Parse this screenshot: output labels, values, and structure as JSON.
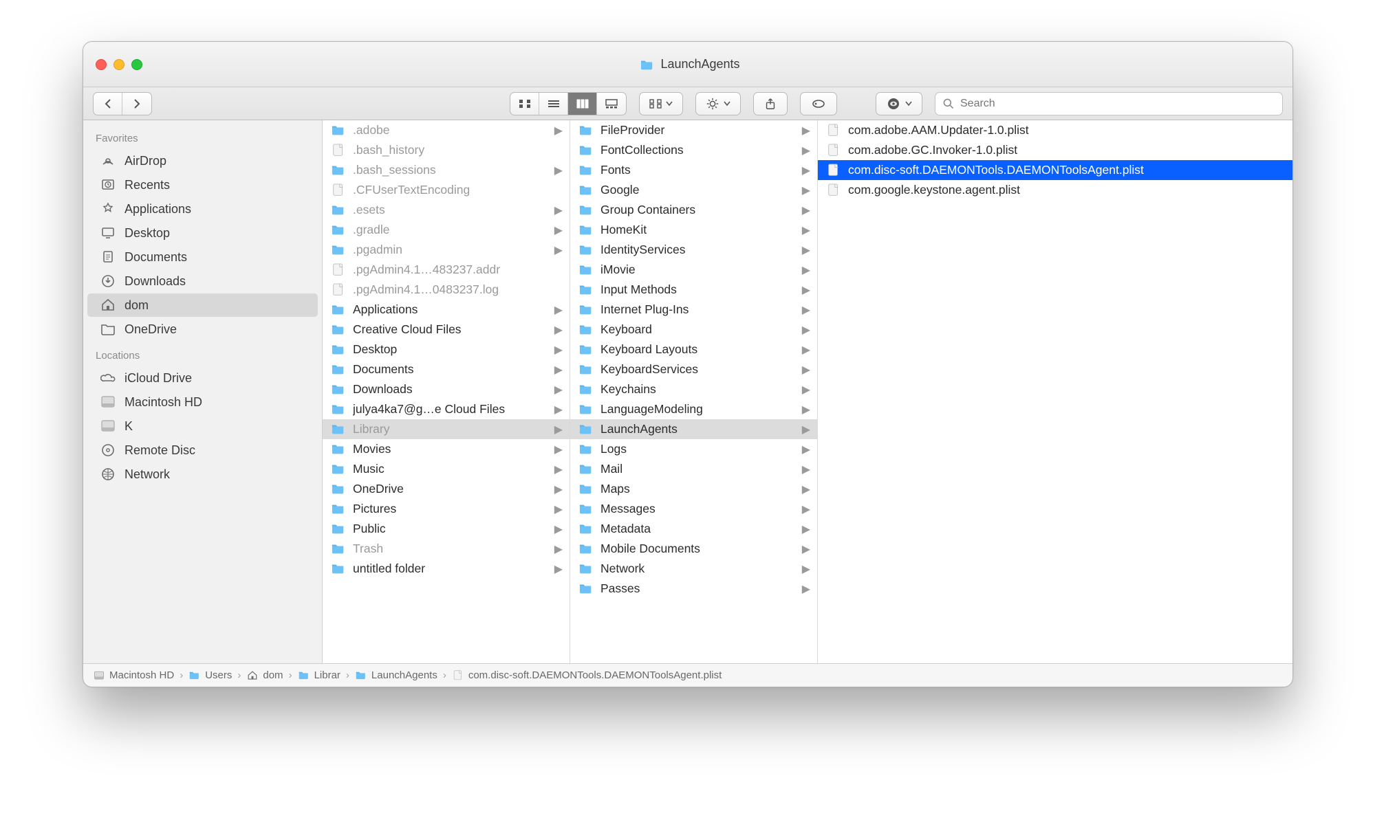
{
  "window": {
    "title": "LaunchAgents"
  },
  "search": {
    "placeholder": "Search"
  },
  "sidebar": {
    "sections": [
      {
        "header": "Favorites",
        "items": [
          {
            "label": "AirDrop",
            "icon": "airdrop",
            "selected": false
          },
          {
            "label": "Recents",
            "icon": "recents",
            "selected": false
          },
          {
            "label": "Applications",
            "icon": "apps",
            "selected": false
          },
          {
            "label": "Desktop",
            "icon": "desktop",
            "selected": false
          },
          {
            "label": "Documents",
            "icon": "documents",
            "selected": false
          },
          {
            "label": "Downloads",
            "icon": "downloads",
            "selected": false
          },
          {
            "label": "dom",
            "icon": "home",
            "selected": true
          },
          {
            "label": "OneDrive",
            "icon": "folder",
            "selected": false
          }
        ]
      },
      {
        "header": "Locations",
        "items": [
          {
            "label": "iCloud Drive",
            "icon": "cloud",
            "selected": false
          },
          {
            "label": "Macintosh HD",
            "icon": "disk",
            "selected": false
          },
          {
            "label": "K",
            "icon": "disk",
            "selected": false
          },
          {
            "label": "Remote Disc",
            "icon": "disc",
            "selected": false
          },
          {
            "label": "Network",
            "icon": "network",
            "selected": false
          }
        ]
      }
    ]
  },
  "columns": [
    [
      {
        "label": ".adobe",
        "type": "folder",
        "dim": true,
        "expand": true
      },
      {
        "label": ".bash_history",
        "type": "file",
        "dim": true,
        "expand": false
      },
      {
        "label": ".bash_sessions",
        "type": "folder",
        "dim": true,
        "expand": true
      },
      {
        "label": ".CFUserTextEncoding",
        "type": "file",
        "dim": true,
        "expand": false
      },
      {
        "label": ".esets",
        "type": "folder",
        "dim": true,
        "expand": true
      },
      {
        "label": ".gradle",
        "type": "folder",
        "dim": true,
        "expand": true
      },
      {
        "label": ".pgadmin",
        "type": "folder",
        "dim": true,
        "expand": true
      },
      {
        "label": ".pgAdmin4.1…483237.addr",
        "type": "file",
        "dim": true,
        "expand": false
      },
      {
        "label": ".pgAdmin4.1…0483237.log",
        "type": "file",
        "dim": true,
        "expand": false
      },
      {
        "label": "Applications",
        "type": "folder",
        "expand": true
      },
      {
        "label": "Creative Cloud Files",
        "type": "folder",
        "expand": true
      },
      {
        "label": "Desktop",
        "type": "folder",
        "expand": true
      },
      {
        "label": "Documents",
        "type": "folder",
        "expand": true
      },
      {
        "label": "Downloads",
        "type": "folder",
        "expand": true
      },
      {
        "label": "julya4ka7@g…e Cloud Files",
        "type": "folder",
        "expand": true
      },
      {
        "label": "Library",
        "type": "folder",
        "dim": true,
        "expand": true,
        "pathSelected": true
      },
      {
        "label": "Movies",
        "type": "folder",
        "expand": true
      },
      {
        "label": "Music",
        "type": "folder",
        "expand": true
      },
      {
        "label": "OneDrive",
        "type": "folder",
        "expand": true
      },
      {
        "label": "Pictures",
        "type": "folder",
        "expand": true
      },
      {
        "label": "Public",
        "type": "folder",
        "expand": true
      },
      {
        "label": "Trash",
        "type": "folder",
        "dim": true,
        "expand": true
      },
      {
        "label": "untitled folder",
        "type": "folder",
        "expand": true
      }
    ],
    [
      {
        "label": "FileProvider",
        "type": "folder",
        "expand": true
      },
      {
        "label": "FontCollections",
        "type": "folder",
        "expand": true
      },
      {
        "label": "Fonts",
        "type": "folder",
        "expand": true
      },
      {
        "label": "Google",
        "type": "folder",
        "expand": true
      },
      {
        "label": "Group Containers",
        "type": "folder",
        "expand": true
      },
      {
        "label": "HomeKit",
        "type": "folder",
        "expand": true
      },
      {
        "label": "IdentityServices",
        "type": "folder",
        "expand": true
      },
      {
        "label": "iMovie",
        "type": "folder",
        "expand": true
      },
      {
        "label": "Input Methods",
        "type": "folder",
        "expand": true
      },
      {
        "label": "Internet Plug-Ins",
        "type": "folder",
        "expand": true
      },
      {
        "label": "Keyboard",
        "type": "folder",
        "expand": true
      },
      {
        "label": "Keyboard Layouts",
        "type": "folder",
        "expand": true
      },
      {
        "label": "KeyboardServices",
        "type": "folder",
        "expand": true
      },
      {
        "label": "Keychains",
        "type": "folder",
        "expand": true
      },
      {
        "label": "LanguageModeling",
        "type": "folder",
        "expand": true
      },
      {
        "label": "LaunchAgents",
        "type": "folder",
        "expand": true,
        "pathSelected": true
      },
      {
        "label": "Logs",
        "type": "folder",
        "expand": true
      },
      {
        "label": "Mail",
        "type": "folder",
        "expand": true
      },
      {
        "label": "Maps",
        "type": "folder",
        "expand": true
      },
      {
        "label": "Messages",
        "type": "folder",
        "expand": true
      },
      {
        "label": "Metadata",
        "type": "folder",
        "expand": true
      },
      {
        "label": "Mobile Documents",
        "type": "folder",
        "expand": true
      },
      {
        "label": "Network",
        "type": "folder",
        "expand": true
      },
      {
        "label": "Passes",
        "type": "folder",
        "expand": true
      }
    ],
    [
      {
        "label": "com.adobe.AAM.Updater-1.0.plist",
        "type": "file"
      },
      {
        "label": "com.adobe.GC.Invoker-1.0.plist",
        "type": "file"
      },
      {
        "label": "com.disc-soft.DAEMONTools.DAEMONToolsAgent.plist",
        "type": "file",
        "selected": true
      },
      {
        "label": "com.google.keystone.agent.plist",
        "type": "file"
      }
    ]
  ],
  "pathbar": [
    {
      "label": "Macintosh HD",
      "icon": "disk"
    },
    {
      "label": "Users",
      "icon": "folder"
    },
    {
      "label": "dom",
      "icon": "home"
    },
    {
      "label": "Library",
      "icon": "folder",
      "truncated": "Librar"
    },
    {
      "label": "LaunchAgents",
      "icon": "folder"
    },
    {
      "label": "com.disc-soft.DAEMONTools.DAEMONToolsAgent.plist",
      "icon": "file"
    }
  ]
}
